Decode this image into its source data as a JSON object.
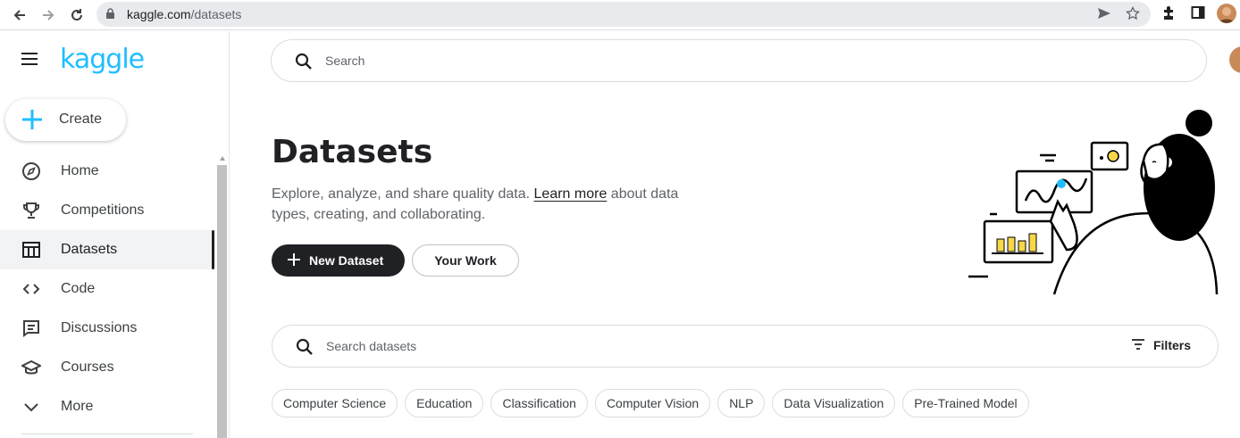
{
  "browser": {
    "url_host": "kaggle.com",
    "url_path": "/datasets"
  },
  "sidebar": {
    "logo": "kaggle",
    "create_label": "Create",
    "items": [
      {
        "label": "Home",
        "icon": "compass-icon"
      },
      {
        "label": "Competitions",
        "icon": "trophy-icon"
      },
      {
        "label": "Datasets",
        "icon": "table-icon",
        "active": true
      },
      {
        "label": "Code",
        "icon": "code-icon"
      },
      {
        "label": "Discussions",
        "icon": "comment-icon"
      },
      {
        "label": "Courses",
        "icon": "school-icon"
      },
      {
        "label": "More",
        "icon": "chevron-down-icon"
      }
    ]
  },
  "header": {
    "search_placeholder": "Search"
  },
  "main": {
    "title": "Datasets",
    "description_pre": "Explore, analyze, and share quality data. ",
    "description_link": "Learn more",
    "description_post": " about data types, creating, and collaborating.",
    "new_dataset_label": "New Dataset",
    "your_work_label": "Your Work",
    "dataset_search_placeholder": "Search datasets",
    "filters_label": "Filters",
    "chips": [
      "Computer Science",
      "Education",
      "Classification",
      "Computer Vision",
      "NLP",
      "Data Visualization",
      "Pre-Trained Model"
    ]
  },
  "colors": {
    "brand": "#20beff",
    "primary_button": "#202124"
  }
}
